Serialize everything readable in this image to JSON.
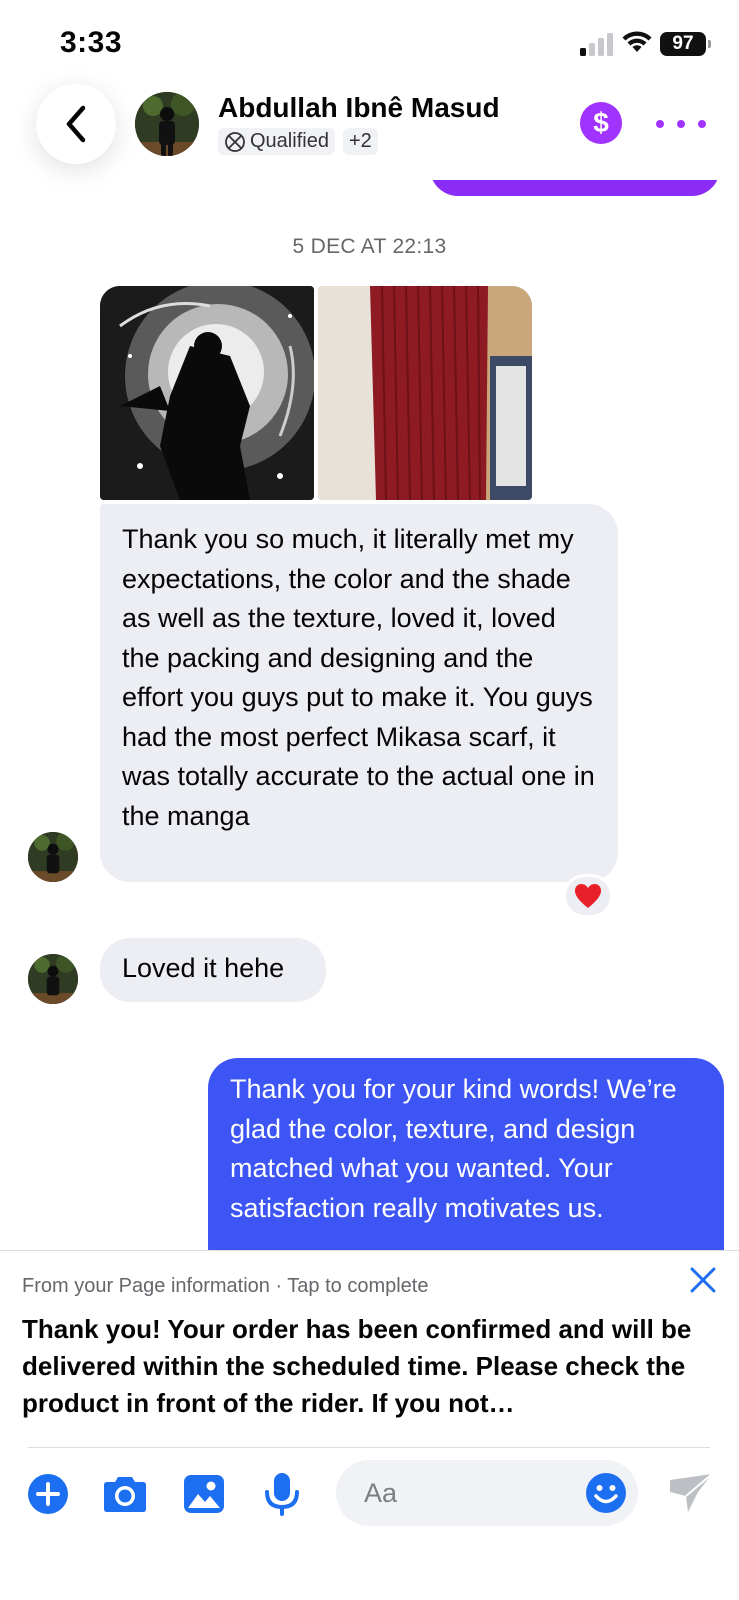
{
  "status_bar": {
    "time": "3:33",
    "battery": "97",
    "icons": [
      "cellular-signal-icon",
      "wifi-icon",
      "battery-icon"
    ]
  },
  "header": {
    "contact_name": "Abdullah Ibnê Masud",
    "label_badge": "Qualified",
    "extra_labels": "+2",
    "icons": [
      "back-arrow-icon",
      "dollar-icon",
      "more-dots-icon"
    ],
    "accent_color": "#a033ff"
  },
  "conversation": {
    "timestamp": "5 DEC AT 22:13",
    "attachments": [
      "anime-artwork-photo",
      "red-scarf-photo"
    ],
    "messages": [
      {
        "direction": "received",
        "text": "Thank you so much, it literally met my expectations, the color and the shade as well as the texture, loved it, loved the packing and designing and the effort you guys put to make it. You guys had the most perfect Mikasa scarf, it was totally accurate to the actual one in the manga",
        "reaction": "❤️"
      },
      {
        "direction": "received",
        "text": "Loved it hehe"
      },
      {
        "direction": "sent",
        "text": "Thank you for your kind words! We’re glad the color, texture, and design matched what you wanted. Your satisfaction really motivates us."
      }
    ],
    "sent_bubble_color": "#3d55f5",
    "received_bubble_color": "#eceef3"
  },
  "suggestion": {
    "header": "From your Page information · Tap to complete",
    "text": "Thank you! Your order has been confirmed and will be delivered within the scheduled time. Please check the product in front of the rider. If you not…"
  },
  "composer": {
    "placeholder": "Aa",
    "icons": [
      "add-icon",
      "camera-icon",
      "gallery-icon",
      "microphone-icon",
      "emoji-icon",
      "send-icon"
    ]
  }
}
